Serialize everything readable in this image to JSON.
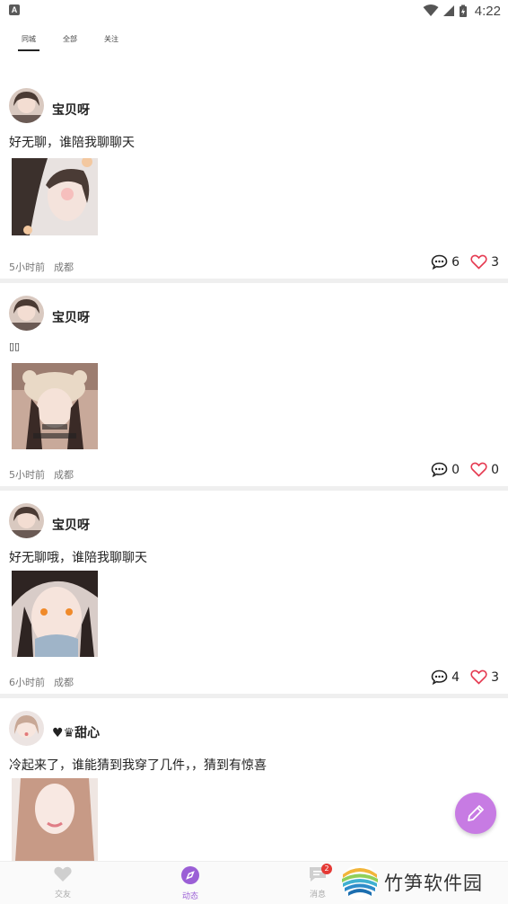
{
  "status_bar": {
    "time": "4:22",
    "left_badge": "A"
  },
  "tabs": [
    {
      "label": "同城",
      "active": true
    },
    {
      "label": "全部",
      "active": false
    },
    {
      "label": "关注",
      "active": false
    }
  ],
  "posts": [
    {
      "username": "宝贝呀",
      "content": "好无聊，谁陪我聊聊天",
      "time": "5小时前",
      "location": "成都",
      "comments": "6",
      "likes": "3"
    },
    {
      "username": "宝贝呀",
      "content": "▯▯",
      "time": "5小时前",
      "location": "成都",
      "comments": "0",
      "likes": "0"
    },
    {
      "username": "宝贝呀",
      "content": "好无聊哦，谁陪我聊聊天",
      "time": "6小时前",
      "location": "成都",
      "comments": "4",
      "likes": "3"
    },
    {
      "username": "♥♛甜心",
      "content": "冷起来了，谁能猜到我穿了几件，，猜到有惊喜"
    }
  ],
  "bottom_nav": [
    {
      "label": "交友",
      "icon": "heart-icon",
      "active": false
    },
    {
      "label": "动态",
      "icon": "compass-icon",
      "active": true
    },
    {
      "label": "消息",
      "icon": "message-icon",
      "active": false,
      "badge": "2"
    }
  ],
  "fab": {
    "icon": "pencil-icon"
  },
  "watermark": {
    "text": "竹笋软件园"
  },
  "colors": {
    "accent": "#9b5fd6",
    "fab": "#c77be3",
    "like": "#e53950",
    "separator": "#efefef"
  }
}
